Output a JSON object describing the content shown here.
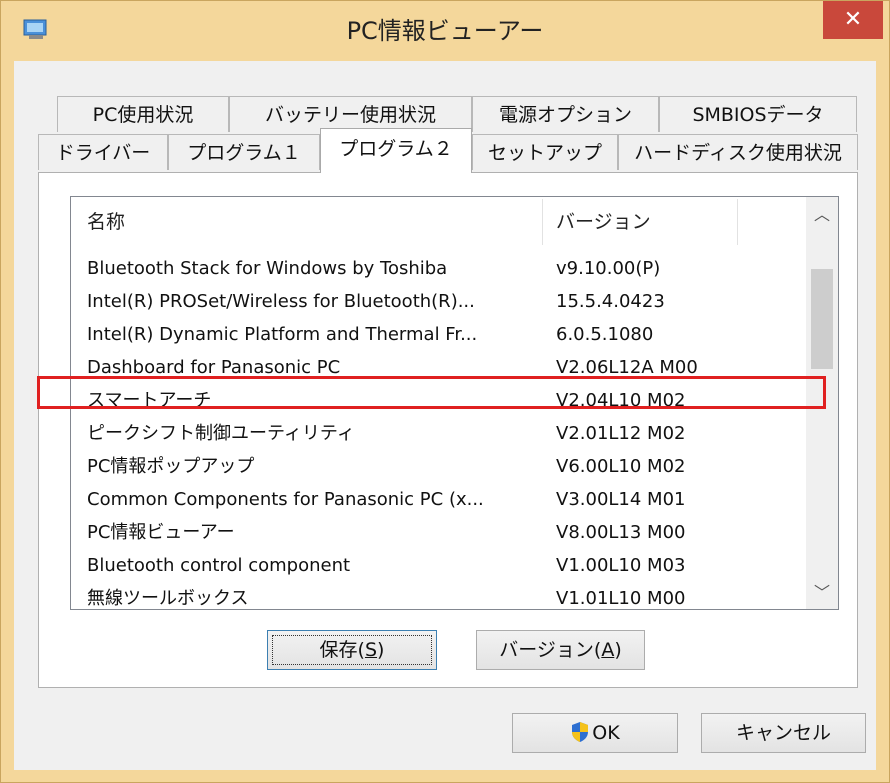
{
  "window": {
    "title": "PC情報ビューアー",
    "close_label": "✕"
  },
  "tabs_row1": [
    "PC使用状況",
    "バッテリー使用状況",
    "電源オプション",
    "SMBIOSデータ"
  ],
  "tabs_row2": [
    "ドライバー",
    "プログラム１",
    "プログラム２",
    "セットアップ",
    "ハードディスク使用状況"
  ],
  "active_tab": "プログラム２",
  "list": {
    "columns": [
      "名称",
      "バージョン"
    ],
    "rows": [
      [
        "Bluetooth Stack for Windows by Toshiba",
        "v9.10.00(P)"
      ],
      [
        "Intel(R) PROSet/Wireless for Bluetooth(R)...",
        "15.5.4.0423"
      ],
      [
        "Intel(R) Dynamic Platform and Thermal Fr...",
        "6.0.5.1080"
      ],
      [
        "Dashboard for Panasonic PC",
        "V2.06L12A M00"
      ],
      [
        "スマートアーチ",
        "V2.04L10 M02"
      ],
      [
        "ピークシフト制御ユーティリティ",
        "V2.01L12 M02"
      ],
      [
        "PC情報ポップアップ",
        "V6.00L10 M02"
      ],
      [
        "Common Components for Panasonic PC (x...",
        "V3.00L14 M01"
      ],
      [
        "PC情報ビューアー",
        "V8.00L13 M00"
      ],
      [
        "Bluetooth control component",
        "V1.00L10 M03"
      ],
      [
        "無線ツールボックス",
        "V1.01L10 M00"
      ]
    ],
    "highlighted_row": "スマートアーチ"
  },
  "buttons": {
    "save": {
      "label": "保存(",
      "mnemonic": "S",
      "suffix": ")"
    },
    "version": {
      "label": "バージョン(",
      "mnemonic": "A",
      "suffix": ")"
    },
    "ok": "OK",
    "cancel": "キャンセル"
  },
  "colors": {
    "frame": "#f4d79b",
    "close": "#c9483b",
    "highlight": "#e02020"
  },
  "icons": [
    "app-icon",
    "close-icon",
    "scroll-up-icon",
    "scroll-down-icon",
    "uac-shield-icon"
  ]
}
